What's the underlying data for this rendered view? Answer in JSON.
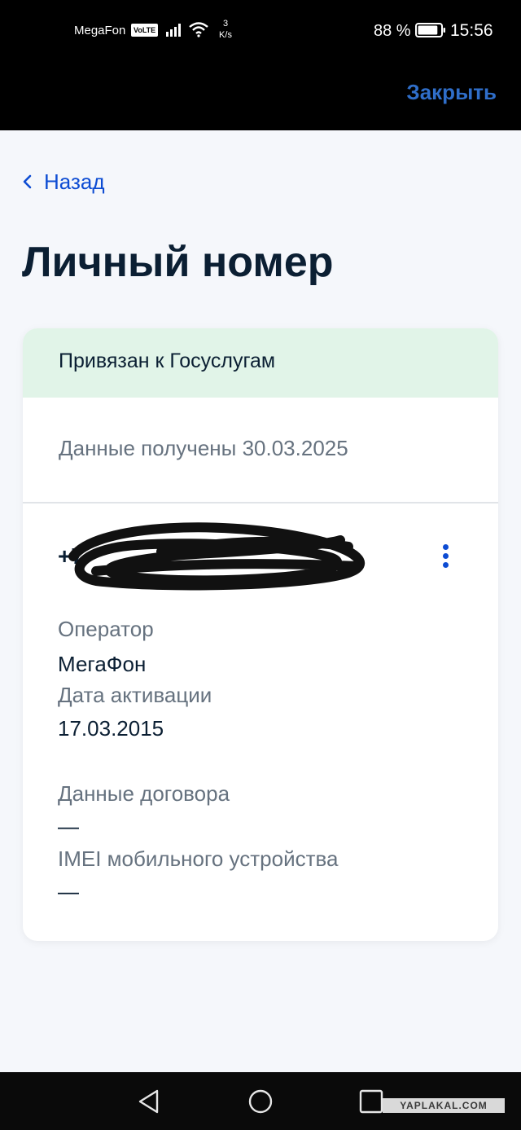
{
  "status_bar": {
    "carrier": "MegaFon",
    "volte": "VoLTE",
    "speed_value": "3",
    "speed_unit": "K/s",
    "battery_percent": "88 %",
    "battery_level": 0.88,
    "time": "15:56"
  },
  "header": {
    "close_label": "Закрыть"
  },
  "nav": {
    "back_label": "Назад"
  },
  "page": {
    "title": "Личный номер"
  },
  "card": {
    "banner": "Привязан к Госуслугам",
    "received": "Данные получены 30.03.2025",
    "phone_visible": "+7",
    "fields": {
      "operator_label": "Оператор",
      "operator_value": "МегаФон",
      "activation_label": "Дата активации",
      "activation_value": "17.03.2015",
      "contract_label": "Данные договора",
      "contract_value": "—",
      "imei_label": "IMEI мобильного устройства",
      "imei_value": "—"
    }
  },
  "watermark": "YAPLAKAL.COM",
  "colors": {
    "accent": "#0d4cd3",
    "close": "#2f6ec9",
    "banner_bg": "#e1f4e8",
    "page_bg": "#f5f7fb",
    "text_primary": "#0b1f33",
    "text_secondary": "#66727f"
  },
  "icons": {
    "back": "chevron-left-icon",
    "more": "more-vertical-icon",
    "signal": "signal-icon",
    "wifi": "wifi-icon",
    "battery": "battery-icon",
    "nav_back": "triangle-back-icon",
    "nav_home": "circle-home-icon",
    "nav_recent": "square-recent-icon"
  }
}
